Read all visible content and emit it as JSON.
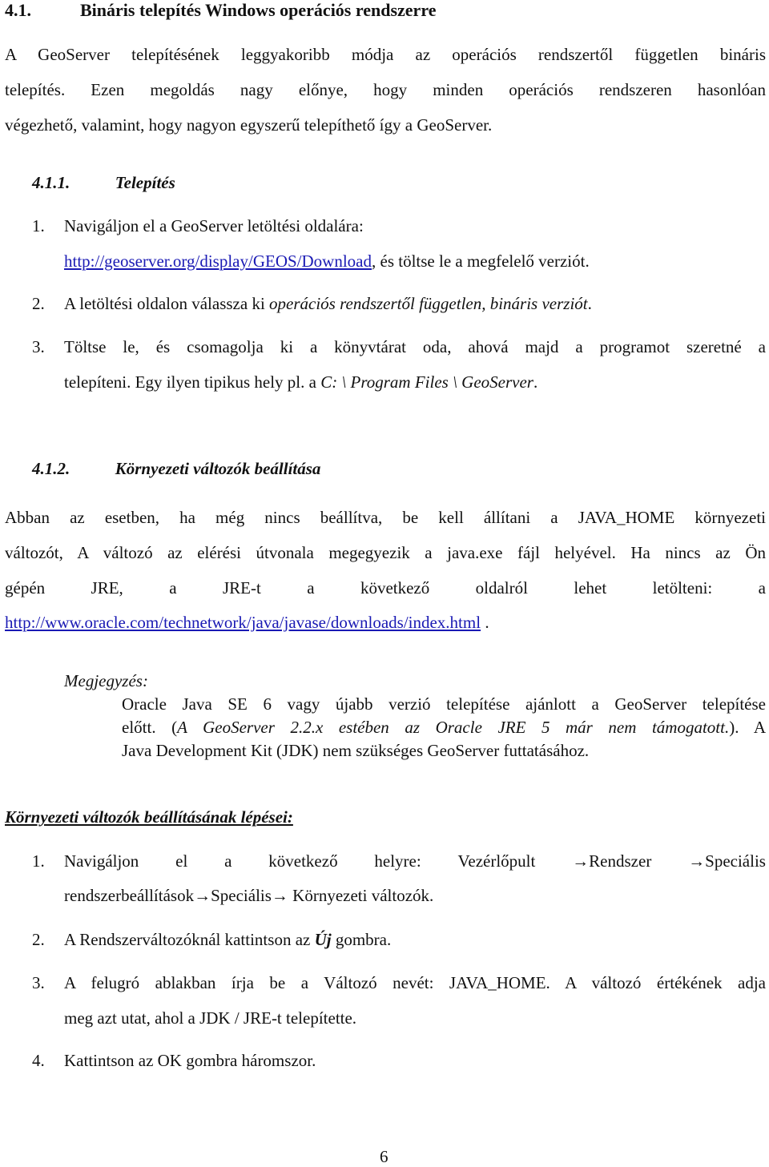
{
  "section": {
    "number": "4.1.",
    "title": "Bináris telepítés Windows operációs rendszerre",
    "intro_lines": [
      "A GeoServer telepítésének leggyakoribb módja az operációs rendszertől független bináris",
      "telepítés. Ezen megoldás nagy előnye, hogy minden operációs rendszeren hasonlóan",
      "végezhető, valamint, hogy nagyon egyszerű telepíthető így a GeoServer."
    ]
  },
  "install": {
    "number": "4.1.1.",
    "title": "Telepítés",
    "steps": [
      {
        "num": "1.",
        "line1": "Navigáljon el a GeoServer letöltési oldalára:",
        "link": "http://geoserver.org/display/GEOS/Download",
        "line2_rest": ", és töltse le a megfelelő verziót."
      },
      {
        "num": "2.",
        "text_before": "A letöltési oldalon válassza ki ",
        "text_italic": "operációs rendszertől független, bináris verziót",
        "text_after": "."
      },
      {
        "num": "3.",
        "line1": "Töltse le, és csomagolja ki a könyvtárat oda, ahová majd a programot szeretné a",
        "line2_before": "telepíteni. Egy ilyen tipikus hely pl. a ",
        "line2_italic": "C: \\ Program Files \\ GeoServer",
        "line2_after": "."
      }
    ]
  },
  "env": {
    "number": "4.1.2.",
    "title": "Környezeti változók beállítása",
    "para_lines": [
      "Abban az esetben, ha még nincs beállítva, be kell állítani a JAVA_HOME környezeti",
      "változót, A változó az elérési útvonala megegyezik a java.exe fájl helyével. Ha nincs az Ön",
      "gépén JRE, a JRE-t a következő oldalról lehet letölteni: a"
    ],
    "link": "http://www.oracle.com/technetwork/java/javase/downloads/index.html",
    "link_after": " .",
    "note": {
      "label": "Megjegyzés:",
      "line1": "Oracle Java SE 6 vagy újabb verzió telepítése ajánlott a GeoServer telepítése",
      "line2_before": "előtt. (",
      "line2_italic": "A GeoServer 2.2.x estében az Oracle JRE 5 már nem támogatott.",
      "line2_after": "). A",
      "line3": "Java Development Kit (JDK) nem szükséges GeoServer futtatásához."
    }
  },
  "steps_section": {
    "title": "Környezeti változók beállításának lépései:",
    "steps": [
      {
        "num": "1.",
        "line1_words": [
          "Navigáljon",
          "el",
          "a",
          "következő",
          "helyre:",
          "Vezérlőpult",
          "→Rendszer",
          "→Speciális"
        ],
        "line2": "rendszerbeállítások→Speciális→ Környezeti változók."
      },
      {
        "num": "2.",
        "before": "A Rendszerváltozóknál kattintson az ",
        "bold_italic": "Új",
        "after": " gombra."
      },
      {
        "num": "3.",
        "line1": "A felugró ablakban írja be a Változó nevét: JAVA_HOME. A változó értékének adja",
        "line2": "meg azt utat, ahol a JDK / JRE-t telepítette."
      },
      {
        "num": "4.",
        "text": "Kattintson az OK gombra háromszor."
      }
    ]
  },
  "page_number": "6"
}
